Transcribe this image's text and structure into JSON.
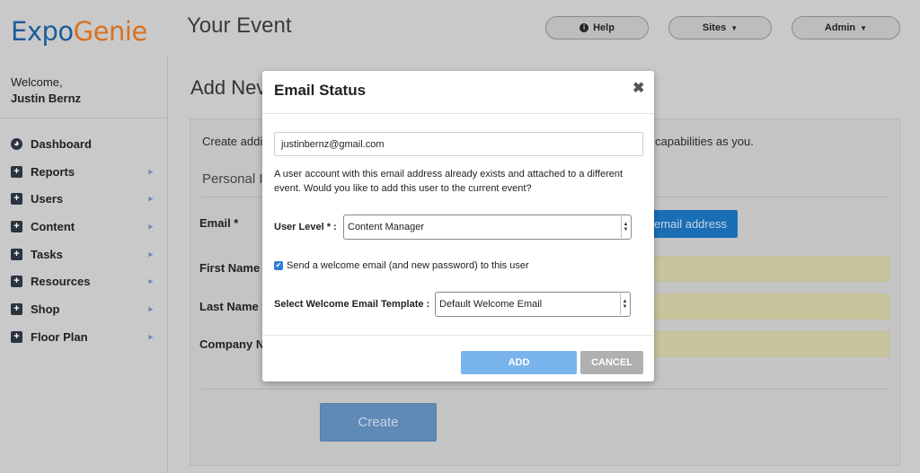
{
  "header": {
    "logo_part1": "Expo",
    "logo_part2": "Genie",
    "event_title": "Your Event",
    "help_label": "Help",
    "sites_label": "Sites",
    "admin_label": "Admin"
  },
  "sidebar": {
    "welcome": "Welcome,",
    "user_name": "Justin Bernz",
    "items": [
      {
        "label": "Dashboard",
        "icon": "dashboard-icon"
      },
      {
        "label": "Reports",
        "icon": "plus-icon"
      },
      {
        "label": "Users",
        "icon": "plus-icon"
      },
      {
        "label": "Content",
        "icon": "plus-icon"
      },
      {
        "label": "Tasks",
        "icon": "plus-icon"
      },
      {
        "label": "Resources",
        "icon": "plus-icon"
      },
      {
        "label": "Shop",
        "icon": "plus-icon"
      },
      {
        "label": "Floor Plan",
        "icon": "plus-icon"
      }
    ]
  },
  "main": {
    "title_visible": "Add Nev",
    "intro_left": "Create addi",
    "intro_right": "capabilities as you.",
    "section_personal": "Personal I",
    "email_label": "Email *",
    "first_name_label": "First Name *",
    "last_name_label": "Last Name *",
    "company_label": "Company Na",
    "email_address_button": "email address",
    "create_button": "Create"
  },
  "modal": {
    "title": "Email Status",
    "email_value": "justinbernz@gmail.com",
    "message": "A user account with this email address already exists and attached to a different event. Would you like to add this user to the current event?",
    "user_level_label": "User Level * :",
    "user_level_value": "Content Manager",
    "welcome_checkbox_label": "Send a welcome email (and new password) to this user",
    "welcome_checked": true,
    "template_label": "Select Welcome Email Template :",
    "template_value": "Default Welcome Email",
    "add_button": "ADD",
    "cancel_button": "CANCEL"
  },
  "colors": {
    "brand_blue": "#1d5d9a",
    "brand_orange": "#d8711f",
    "add_button": "#7ab4ec",
    "cancel_button": "#b0b0b0",
    "overlay_bg": "#c9c9c9"
  }
}
